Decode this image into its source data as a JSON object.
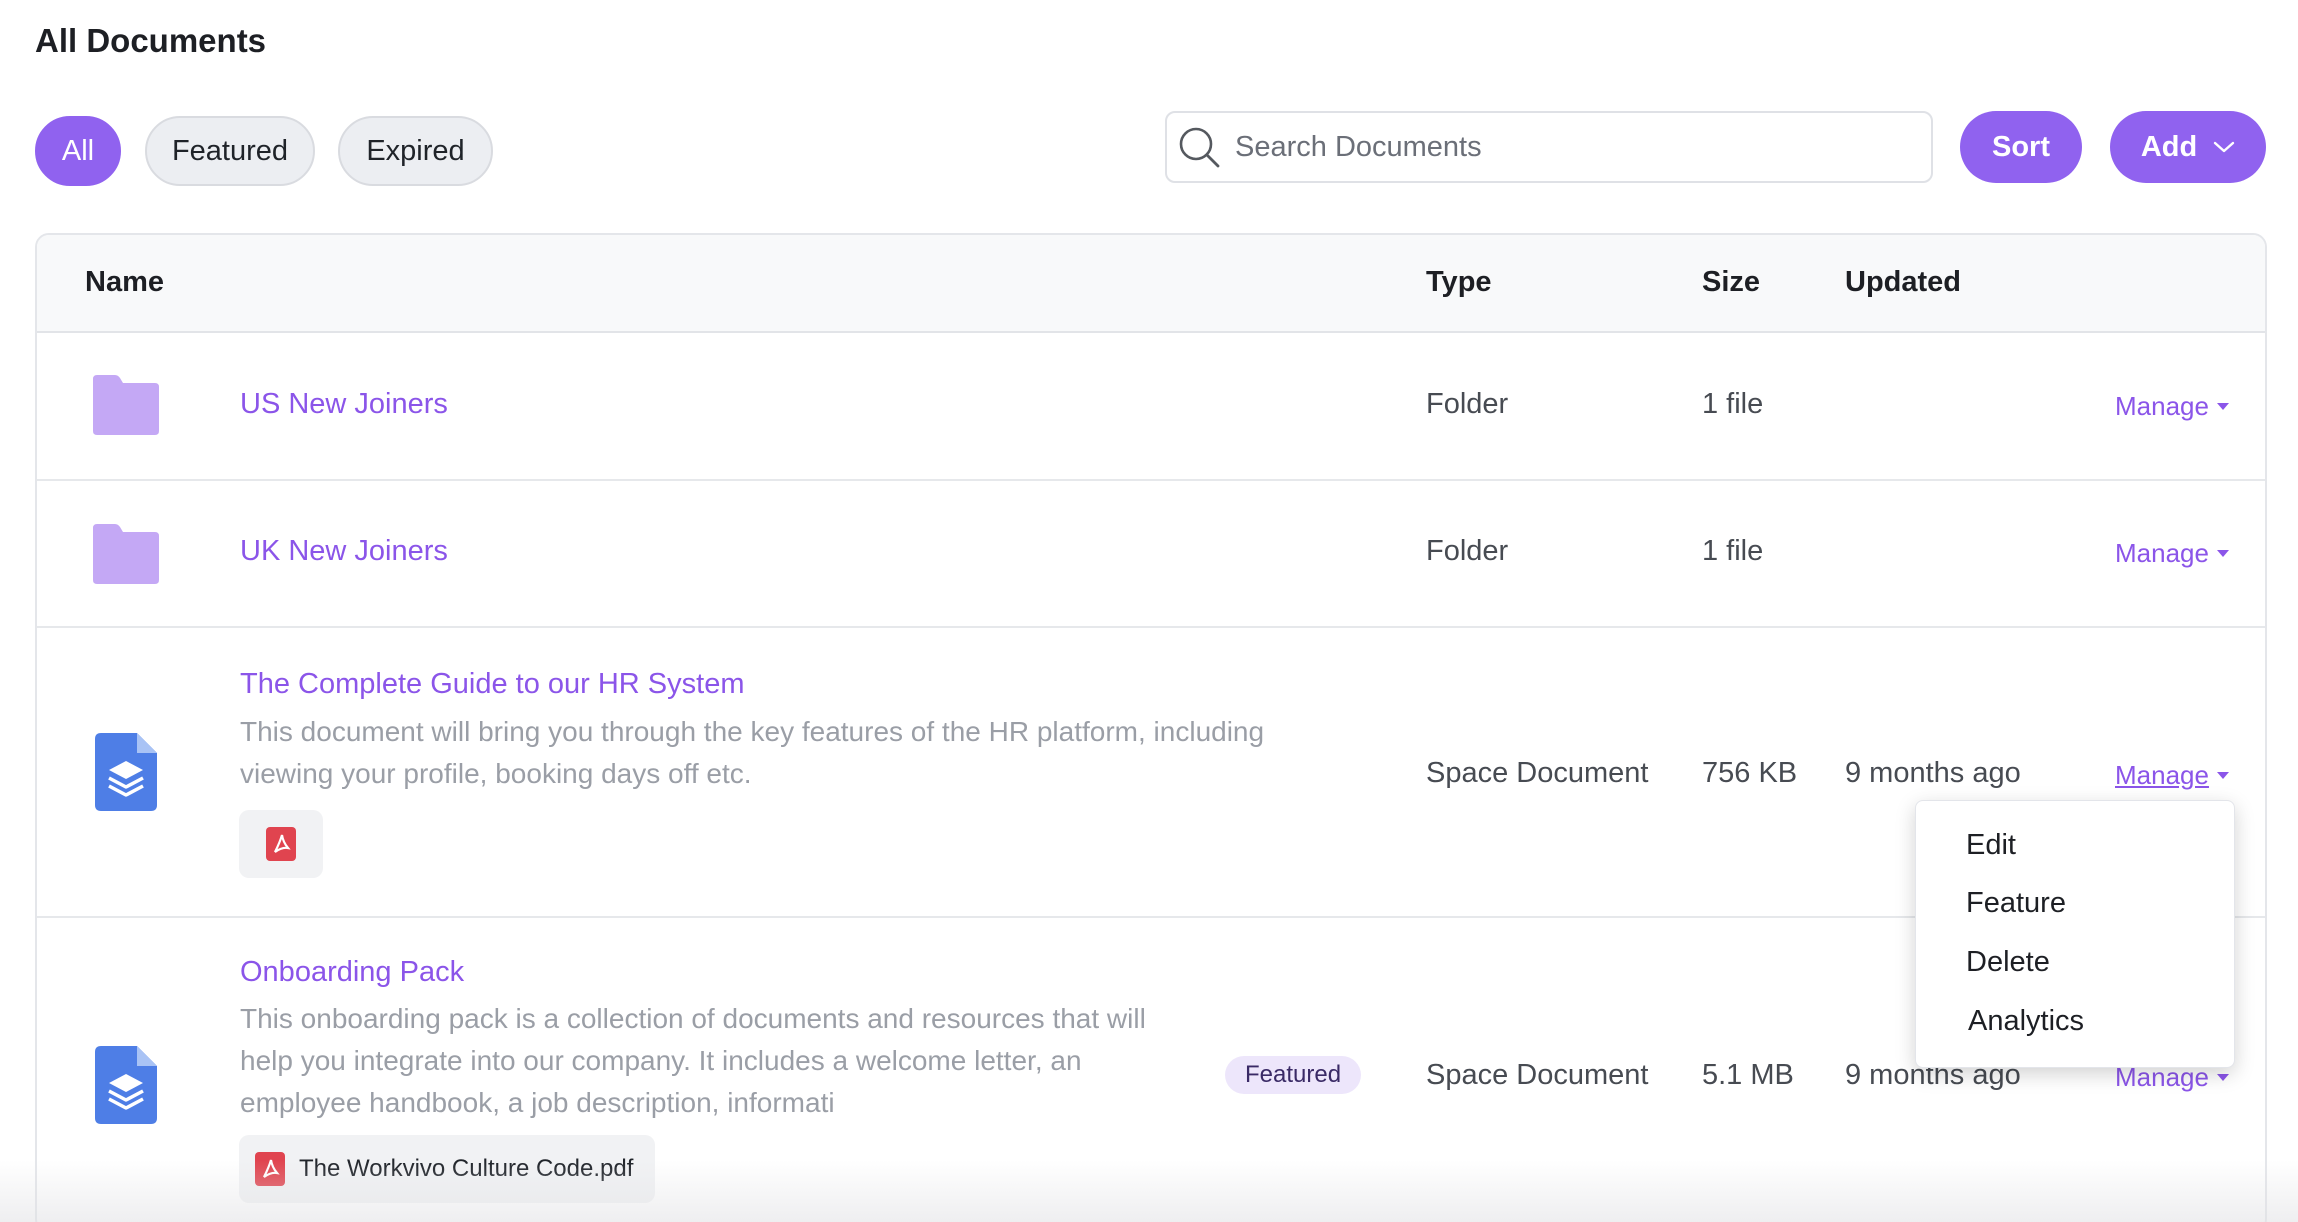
{
  "page": {
    "title": "All Documents"
  },
  "filters": [
    {
      "label": "All",
      "active": true
    },
    {
      "label": "Featured",
      "active": false
    },
    {
      "label": "Expired",
      "active": false
    }
  ],
  "search": {
    "placeholder": "Search Documents",
    "value": ""
  },
  "toolbar": {
    "sort_label": "Sort",
    "add_label": "Add"
  },
  "table": {
    "columns": [
      "Name",
      "Type",
      "Size",
      "Updated"
    ],
    "manage_label": "Manage",
    "rows": [
      {
        "title": "US New Joiners",
        "icon": "folder-icon",
        "type": "Folder",
        "size": "1 file",
        "updated": ""
      },
      {
        "title": "UK New Joiners",
        "icon": "folder-icon",
        "type": "Folder",
        "size": "1 file",
        "updated": ""
      },
      {
        "title": "The Complete Guide to our HR System",
        "icon": "space-document-icon",
        "description_lines": [
          "This document will bring you through the key features of the HR platform, including",
          "viewing your profile, booking days off etc."
        ],
        "attachment_icon": "pdf-icon",
        "type": "Space Document",
        "size": "756 KB",
        "updated": "9 months ago"
      },
      {
        "title": "Onboarding Pack",
        "icon": "space-document-icon",
        "description_lines": [
          "This onboarding pack is a collection of documents and resources that will",
          "help you integrate into our company. It includes a welcome letter, an",
          "employee handbook, a job description, informati"
        ],
        "badge": "Featured",
        "attachment_icon": "pdf-icon",
        "attachment_name": "The Workvivo Culture Code.pdf",
        "type": "Space Document",
        "size": "5.1 MB",
        "updated": "9 months ago"
      }
    ]
  },
  "manage_menu": {
    "items": [
      "Edit",
      "Feature",
      "Delete",
      "Analytics"
    ]
  },
  "colors": {
    "accent": "#9062ef",
    "link": "#8b55e9",
    "folder": "#c4a8f5",
    "doc_icon": "#4e7ee6",
    "pdf": "#e0444f"
  }
}
